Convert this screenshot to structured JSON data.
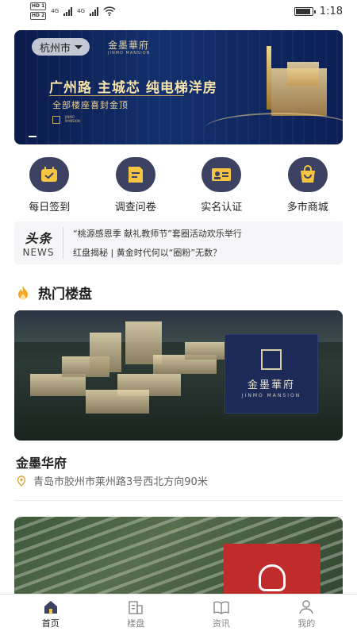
{
  "status_bar": {
    "time": "1:18",
    "sim1": "HD 1",
    "sim2": "HD 2",
    "net1": "4G",
    "net2": "4G"
  },
  "banner": {
    "city": "杭州市",
    "brand": "金墨華府",
    "brand_en": "JINMO MANSION",
    "headline": "广州路 主城芯 纯电梯洋房",
    "subline": "全部楼座喜封金顶",
    "logo_text": "JINMO\nMANSION"
  },
  "quick_icons": [
    {
      "label": "每日签到",
      "icon": "calendar-check-icon"
    },
    {
      "label": "调查问卷",
      "icon": "document-icon"
    },
    {
      "label": "实名认证",
      "icon": "id-card-icon"
    },
    {
      "label": "多市商城",
      "icon": "shopping-bag-icon"
    }
  ],
  "news": {
    "logo_top": "头条",
    "logo_bottom": "NEWS",
    "items": [
      "“桃源感恩季 献礼教师节”套圈活动欢乐举行",
      "红盘揭秘 | 黄金时代何以“圈粉”无数？"
    ]
  },
  "hot_section": {
    "title": "热门楼盘"
  },
  "properties": [
    {
      "name": "金墨华府",
      "address": "青岛市胶州市莱州路3号西北方向90米",
      "sign_cn": "金墨華府",
      "sign_en": "JINMO MANSION"
    }
  ],
  "tabs": [
    {
      "label": "首页",
      "icon": "home-icon",
      "active": true
    },
    {
      "label": "楼盘",
      "icon": "building-icon",
      "active": false
    },
    {
      "label": "资讯",
      "icon": "book-icon",
      "active": false
    },
    {
      "label": "我的",
      "icon": "person-icon",
      "active": false
    }
  ],
  "colors": {
    "icon_circle": "#3d4263",
    "news_bg": "#f6f6f8",
    "banner_bg": "#13306e",
    "gold": "#f6e3a9",
    "flame": "#f5a623"
  }
}
